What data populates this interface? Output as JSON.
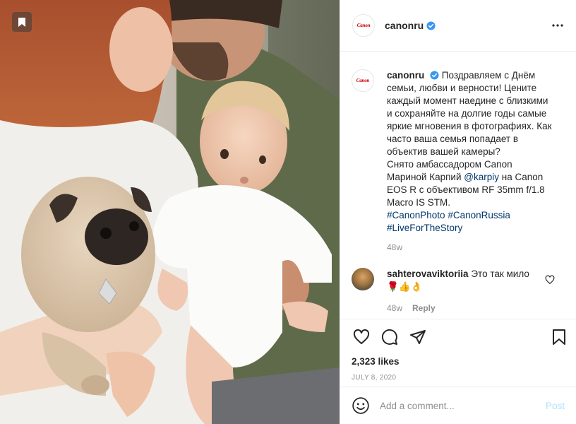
{
  "post": {
    "username": "canonru",
    "avatar_logo": "Canon",
    "photo_alt": "Family photo with baby and pug"
  },
  "caption": {
    "username": "canonru",
    "text_1": "Поздравляем с Днём семьи, любви и верности! Цените каждый момент наедине с близкими и сохраняйте на долгие годы самые яркие мгновения в фотографиях. Как часто ваша семья попадает в объектив вашей камеры?",
    "text_2": "Снято амбассадором Canon Мариной Карпий",
    "mention": "@karpiy",
    "text_3": "на Canon EOS R с объективом RF 35mm f/1.8 Macro IS STM.",
    "hashtags": [
      "#CanonPhoto",
      "#CanonRussia",
      "#LiveForTheStory"
    ],
    "time": "48w"
  },
  "comment": {
    "username": "sahterovaviktoriia",
    "text": "Это так мило🌹👍👌",
    "time": "48w",
    "reply_label": "Reply"
  },
  "actions": {
    "likes": "2,323 likes",
    "date": "JULY 8, 2020"
  },
  "add_comment": {
    "placeholder": "Add a comment...",
    "post_label": "Post"
  },
  "icons": {
    "bookmark_badge": "bookmark-icon",
    "verified": "verified-badge-icon",
    "more": "more-options-icon",
    "like": "heart-icon",
    "comment": "comment-bubble-icon",
    "share": "paper-plane-icon",
    "save": "save-bookmark-icon",
    "emoji": "emoji-icon"
  },
  "colors": {
    "verified_blue": "#3897f0",
    "link": "#00376b",
    "muted": "#8e8e8e",
    "post_button": "#b2dffc",
    "canon_red": "#cc0000"
  }
}
